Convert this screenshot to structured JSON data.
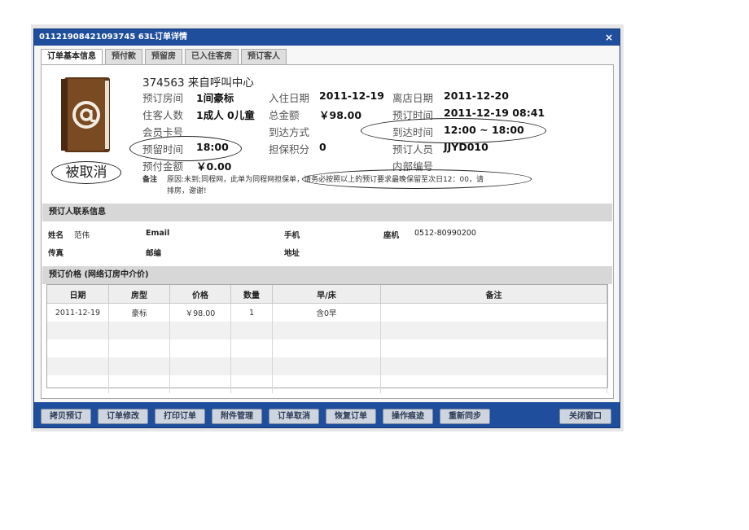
{
  "window": {
    "title": "01121908421093745 63L订单详情",
    "close": "×"
  },
  "tabs": [
    "订单基本信息",
    "预付款",
    "预留房",
    "已入住客房",
    "预订客人"
  ],
  "summary": {
    "id_source": "374563 来自呼叫中心",
    "room_label": "预订房间",
    "room_value": "1间豪标",
    "guests_label": "住客人数",
    "guests_value": "1成人 0儿童",
    "member_label": "会员卡号",
    "member_value": "",
    "hold_label": "预留时间",
    "hold_value": "18:00",
    "prepay_label": "预付金额",
    "prepay_value": "￥0.00",
    "checkin_label": "入住日期",
    "checkin_value": "2011-12-19",
    "total_label": "总金额",
    "total_value": "￥98.00",
    "arrive_mode_label": "到达方式",
    "arrive_mode_value": "",
    "guarantee_label": "担保积分",
    "guarantee_value": "0",
    "checkout_label": "离店日期",
    "checkout_value": "2011-12-20",
    "booktime_label": "预订时间",
    "booktime_value": "2011-12-19 08:41",
    "arrive_time_label": "到达时间",
    "arrive_time_value": "12:00 ~ 18:00",
    "booker_label": "预订人员",
    "booker_value": "JJYD010",
    "internal_label": "内部编号",
    "internal_value": "",
    "cancel_stamp": "被取消",
    "note_label": "备注",
    "note_line1": "原因:未到;同程网，此单为同程网担保单，请务必按照以上的预订要求最晚保留至次日12：00，请",
    "note_line2": "排房，谢谢!"
  },
  "contact": {
    "header": "预订人联系信息",
    "name_label": "姓名",
    "name_value": "范伟",
    "email_label": "Email",
    "email_value": "",
    "mobile_label": "手机",
    "mobile_value": "",
    "phone_label": "座机",
    "phone_value": "0512-80990200",
    "fax_label": "传真",
    "fax_value": "",
    "zip_label": "邮编",
    "zip_value": "",
    "address_label": "地址",
    "address_value": ""
  },
  "price": {
    "header": "预订价格 (网络订房中介价)",
    "columns": [
      "日期",
      "房型",
      "价格",
      "数量",
      "早/床",
      "备注"
    ],
    "rows": [
      [
        "2011-12-19",
        "豪标",
        "￥98.00",
        "1",
        "含0早",
        ""
      ]
    ]
  },
  "toolbar": {
    "buttons": [
      "拷贝预订",
      "订单修改",
      "打印订单",
      "附件管理",
      "订单取消",
      "恢复订单",
      "操作痕迹",
      "重新同步"
    ],
    "close": "关闭窗口"
  },
  "colors": {
    "titlebar": "#1f4e9c",
    "book": "#7a4a22",
    "section": "#d7d7d7"
  }
}
